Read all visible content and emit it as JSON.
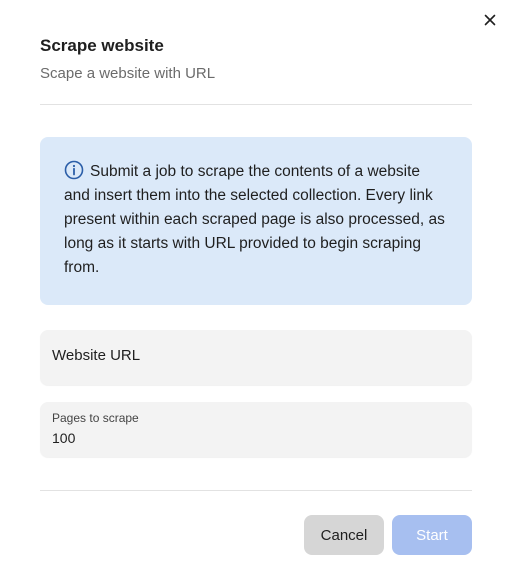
{
  "dialog": {
    "title": "Scrape website",
    "subtitle": "Scape a website with URL",
    "close_icon": "close-icon"
  },
  "info": {
    "icon": "info-icon",
    "text": "Submit a job to scrape the contents of a website and insert them into the selected collection. Every link present within each scraped page is also processed, as long as it starts with URL provided to begin scraping from."
  },
  "url_field": {
    "placeholder": "Website URL",
    "value": ""
  },
  "pages_field": {
    "label": "Pages to scrape",
    "value": "100"
  },
  "buttons": {
    "cancel_label": "Cancel",
    "start_label": "Start"
  },
  "colors": {
    "info_background": "#dbe9f9",
    "info_icon": "#2b5ea8",
    "start_disabled": "#a7bff0",
    "cancel_background": "#d6d6d6"
  }
}
